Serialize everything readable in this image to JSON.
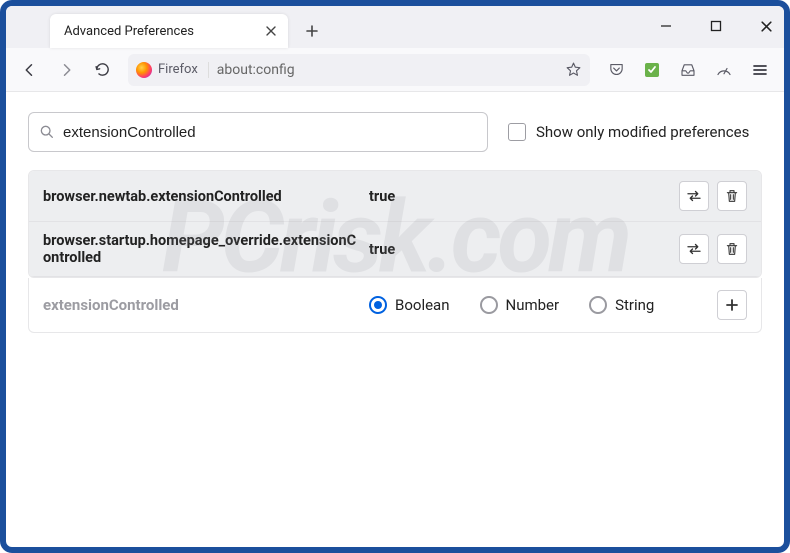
{
  "window": {
    "tab_title": "Advanced Preferences"
  },
  "toolbar": {
    "identity_label": "Firefox",
    "url": "about:config"
  },
  "search": {
    "value": "extensionControlled",
    "show_modified_label": "Show only modified preferences"
  },
  "prefs": [
    {
      "name": "browser.newtab.extensionControlled",
      "value": "true"
    },
    {
      "name": "browser.startup.homepage_override.extensionControlled",
      "value": "true"
    }
  ],
  "newpref": {
    "name": "extensionControlled",
    "types": {
      "boolean": "Boolean",
      "number": "Number",
      "string": "String"
    },
    "selected": "boolean"
  },
  "watermark": "PCrisk.com"
}
